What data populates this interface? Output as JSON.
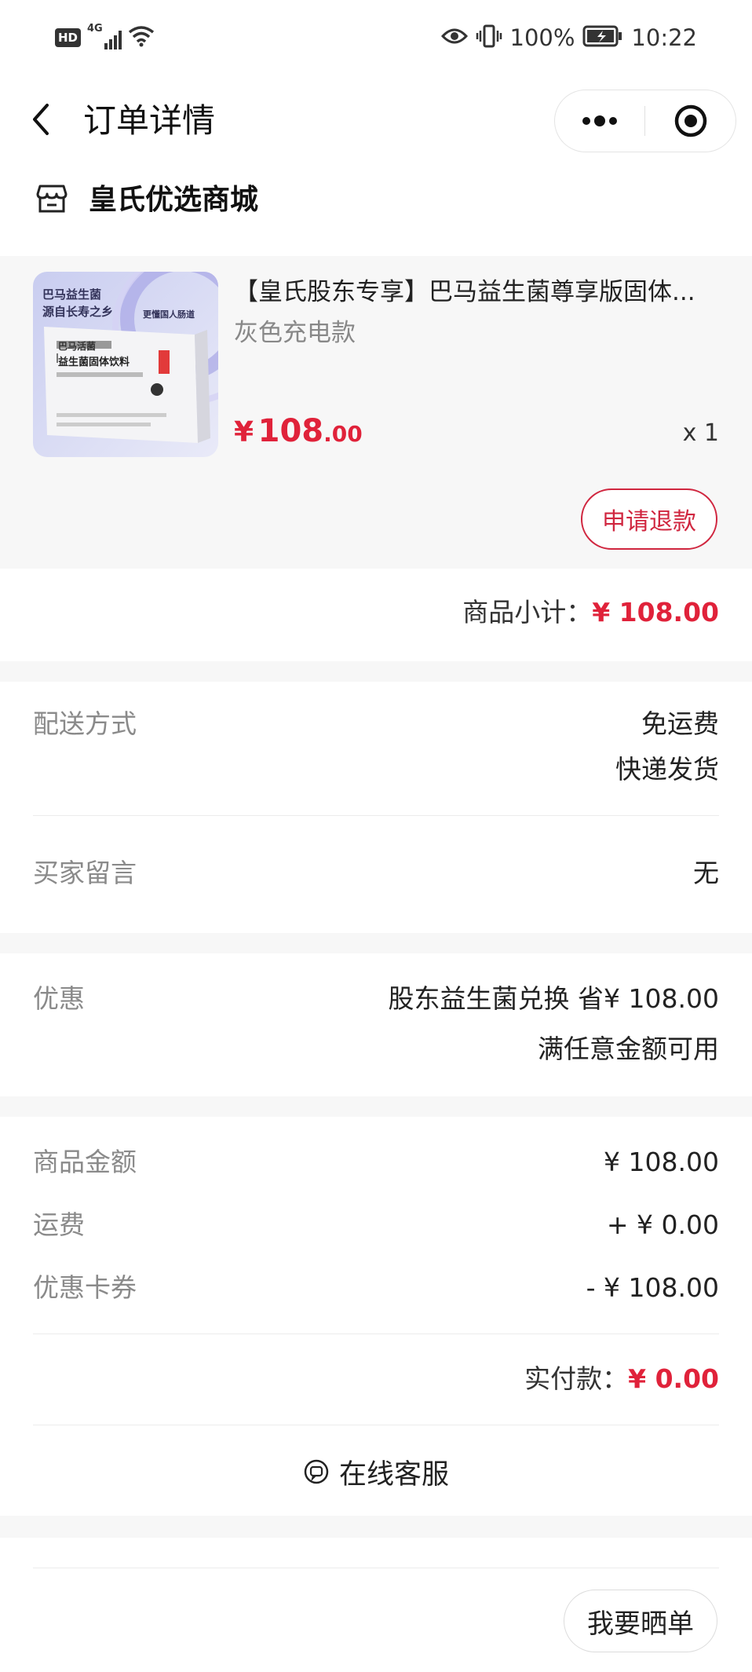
{
  "status_bar": {
    "hd": "HD",
    "network": "4G",
    "battery_percent": "100%",
    "time": "10:22"
  },
  "nav": {
    "title": "订单详情"
  },
  "shop": {
    "name": "皇氏优选商城"
  },
  "product": {
    "title": "【皇氏股东专享】巴马益生菌尊享版固体...",
    "variant": "灰色充电款",
    "price_currency": "¥",
    "price_int": "108",
    "price_dec": ".00",
    "quantity": "x 1",
    "refund_button": "申请退款",
    "image_text": {
      "headline1": "巴马益生菌",
      "headline2": "源自长寿之乡",
      "tagline": "更懂国人肠道",
      "box_line1": "巴马活菌",
      "box_line2": "益生菌固体饮料"
    }
  },
  "subtotal": {
    "label": "商品小计：",
    "value": "¥ 108.00"
  },
  "delivery": {
    "label": "配送方式",
    "value1": "免运费",
    "value2": "快递发货"
  },
  "message": {
    "label": "买家留言",
    "value": "无"
  },
  "discount": {
    "label": "优惠",
    "value1": "股东益生菌兑换 省¥ 108.00",
    "value2": "满任意金额可用"
  },
  "amounts": {
    "goods_label": "商品金额",
    "goods_value": "¥ 108.00",
    "shipping_label": "运费",
    "shipping_value": "+ ¥ 0.00",
    "coupon_label": "优惠卡券",
    "coupon_value": "- ¥ 108.00",
    "paid_label": "实付款：",
    "paid_value": "¥ 0.00"
  },
  "customer_service": {
    "label": "在线客服"
  },
  "share_button": "我要晒单",
  "colors": {
    "accent_red": "#e0223a",
    "background_gray": "#f7f7f7"
  }
}
